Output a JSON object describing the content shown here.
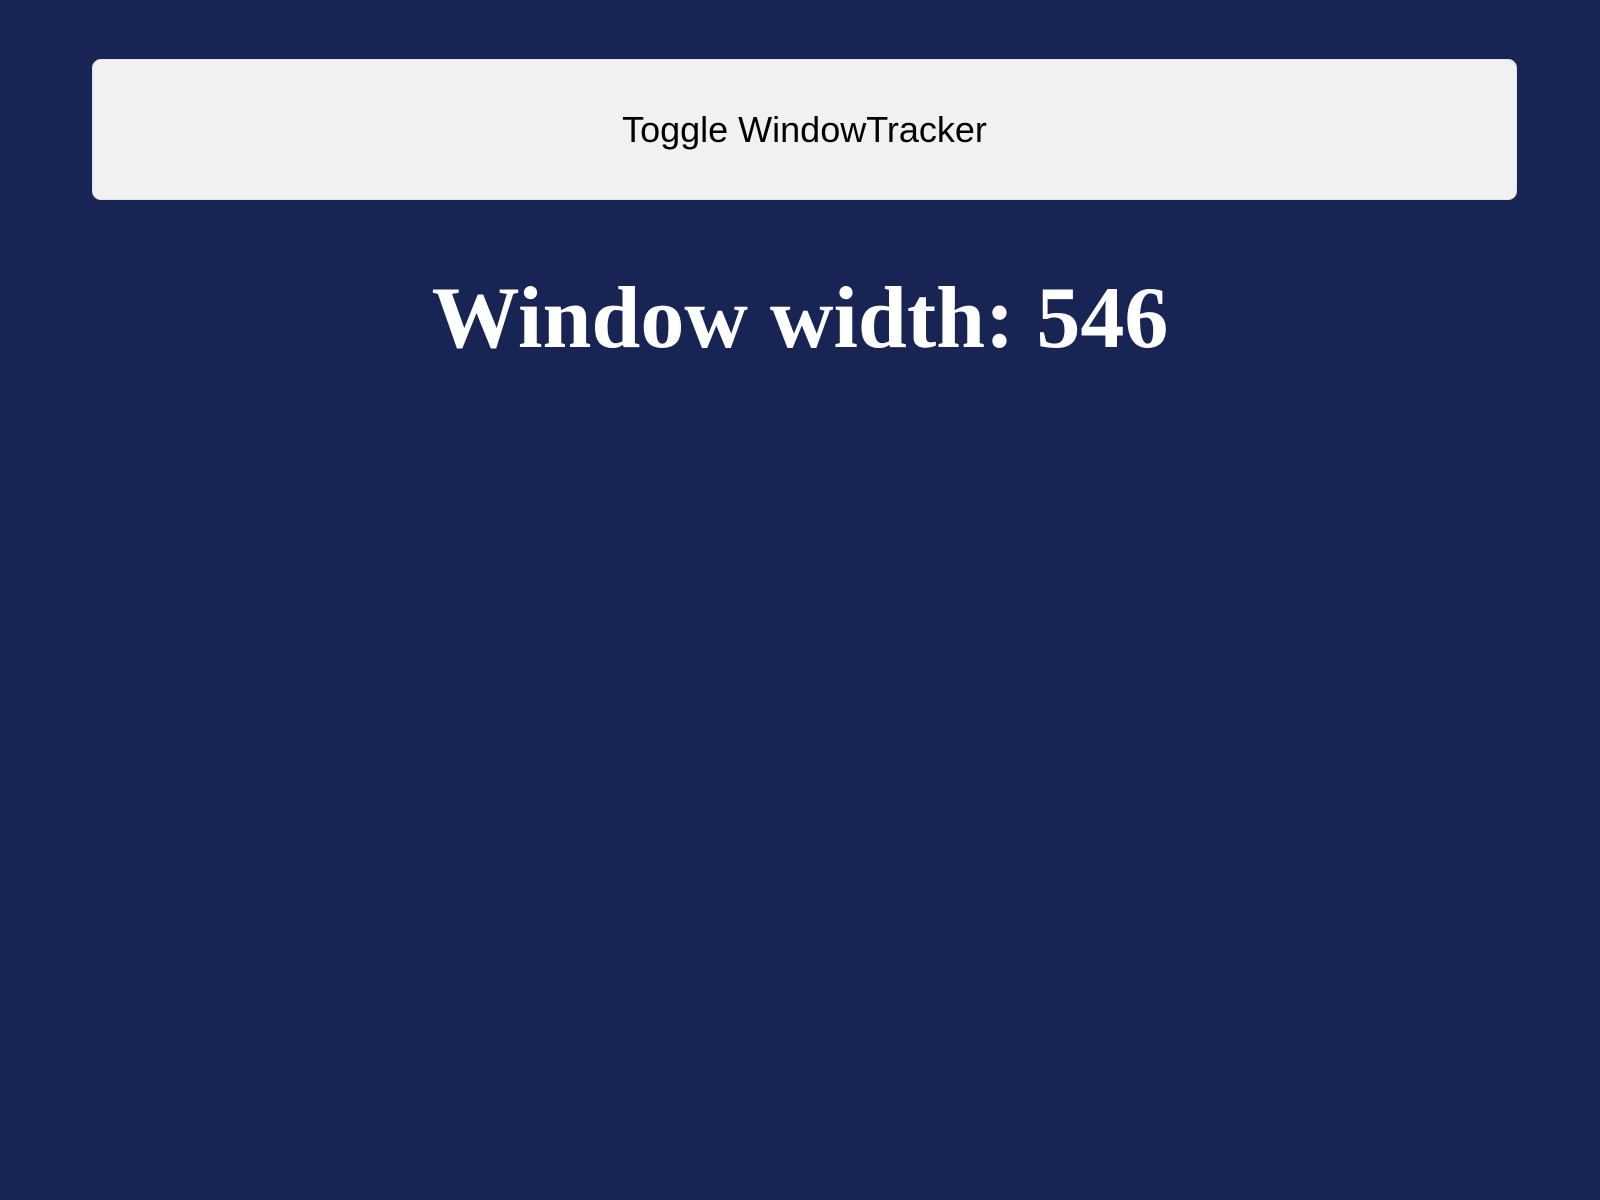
{
  "toggle_button": {
    "label": "Toggle WindowTracker"
  },
  "width_display": {
    "text": "Window width: 546"
  },
  "colors": {
    "background": "#172454",
    "button_background": "#f1f1f1",
    "button_text": "#000000",
    "heading_text": "#ffffff"
  }
}
